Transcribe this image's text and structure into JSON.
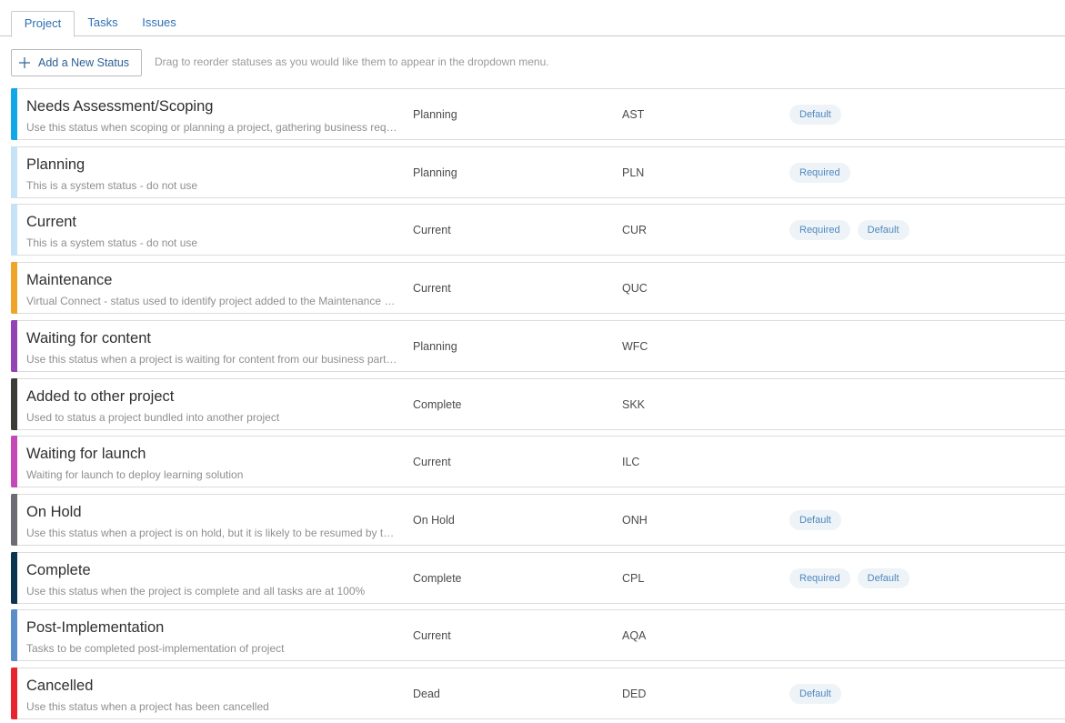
{
  "tabs": [
    {
      "label": "Project",
      "active": true
    },
    {
      "label": "Tasks",
      "active": false
    },
    {
      "label": "Issues",
      "active": false
    }
  ],
  "toolbar": {
    "add_label": "Add a New Status",
    "add_icon": "plus-icon",
    "hint": "Drag to reorder statuses as you would like them to appear in the dropdown menu."
  },
  "statuses": [
    {
      "name": "Needs Assessment/Scoping",
      "description": "Use this status when scoping or planning a project, gathering business requirements",
      "group": "Planning",
      "code": "AST",
      "color": "#10a8e6",
      "badges": [
        "Default"
      ]
    },
    {
      "name": "Planning",
      "description": "This is a system status - do not use",
      "group": "Planning",
      "code": "PLN",
      "color": "#c5e2f6",
      "badges": [
        "Required"
      ]
    },
    {
      "name": "Current",
      "description": "This is a system status - do not use",
      "group": "Current",
      "code": "CUR",
      "color": "#c5e2f6",
      "badges": [
        "Required",
        "Default"
      ]
    },
    {
      "name": "Maintenance",
      "description": "Virtual Connect - status used to identify project added to the Maintenance list",
      "group": "Current",
      "code": "QUC",
      "color": "#f0a42a",
      "badges": []
    },
    {
      "name": "Waiting for content",
      "description": "Use this status when a project is waiting for content from our business partners",
      "group": "Planning",
      "code": "WFC",
      "color": "#9343b4",
      "badges": []
    },
    {
      "name": "Added to other project",
      "description": "Used to status a project bundled into another project",
      "group": "Complete",
      "code": "SKK",
      "color": "#3c3c36",
      "badges": []
    },
    {
      "name": "Waiting for launch",
      "description": "Waiting for launch to deploy learning solution",
      "group": "Current",
      "code": "ILC",
      "color": "#c348b8",
      "badges": []
    },
    {
      "name": "On Hold",
      "description": "Use this status when a project is on hold, but it is likely to be resumed by the team",
      "group": "On Hold",
      "code": "ONH",
      "color": "#6c6c74",
      "badges": [
        "Default"
      ]
    },
    {
      "name": "Complete",
      "description": "Use this status when the project is complete and all tasks are at 100%",
      "group": "Complete",
      "code": "CPL",
      "color": "#0b3450",
      "badges": [
        "Required",
        "Default"
      ]
    },
    {
      "name": "Post-Implementation",
      "description": "Tasks to be completed post-implementation of project",
      "group": "Current",
      "code": "AQA",
      "color": "#5b8dc8",
      "badges": []
    },
    {
      "name": "Cancelled",
      "description": "Use this status when a project has been cancelled",
      "group": "Dead",
      "code": "DED",
      "color": "#e8242e",
      "badges": [
        "Default"
      ]
    }
  ]
}
